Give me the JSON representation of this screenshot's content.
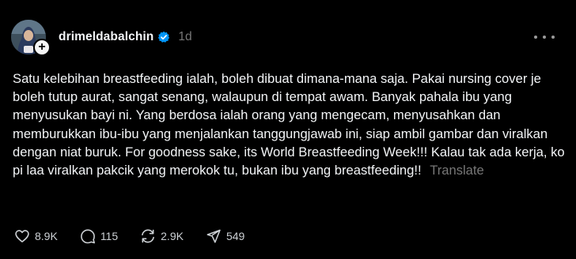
{
  "post": {
    "username": "drimeldabalchin",
    "verified": true,
    "time": "1d",
    "text": "Satu kelebihan breastfeeding ialah, boleh dibuat dimana-mana saja. Pakai nursing cover je boleh tutup aurat, sangat senang, walaupun di tempat awam. Banyak pahala ibu yang menyusukan bayi ni. Yang berdosa ialah orang yang mengecam, menyusahkan dan memburukkan ibu-ibu yang menjalankan tanggungjawab ini, siap ambil gambar dan viralkan dengan niat buruk. For goodness sake, its World Breastfeeding Week!!! Kalau tak ada kerja, ko pi laa viralkan pakcik yang merokok tu, bukan ibu yang breastfeeding!!",
    "translate_label": "Translate"
  },
  "actions": {
    "likes": "8.9K",
    "replies": "115",
    "reposts": "2.9K",
    "shares": "549"
  },
  "icons": {
    "verified": "verified-badge-icon",
    "follow": "plus-icon",
    "more": "more-dots-icon",
    "like": "heart-icon",
    "reply": "comment-bubble-icon",
    "repost": "repost-arrows-icon",
    "share": "send-icon"
  },
  "colors": {
    "background": "#000000",
    "text": "#f3f5f7",
    "muted": "#777777",
    "verified": "#0095f6"
  }
}
